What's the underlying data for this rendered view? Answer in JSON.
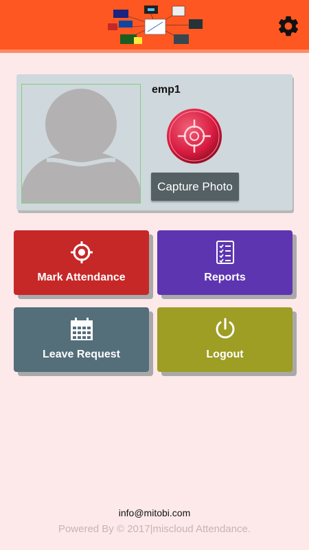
{
  "header": {
    "brand_color": "#ff5722",
    "settings_icon": "gear-icon"
  },
  "profile": {
    "employee_name": "emp1",
    "avatar_icon": "user-silhouette-icon",
    "capture_icon": "target-icon",
    "capture_label": "Capture Photo"
  },
  "tiles": [
    {
      "label": "Mark Attendance",
      "icon": "target-icon",
      "color": "#c62828"
    },
    {
      "label": "Reports",
      "icon": "checklist-icon",
      "color": "#5e35b1"
    },
    {
      "label": "Leave Request",
      "icon": "calendar-icon",
      "color": "#546e7a"
    },
    {
      "label": "Logout",
      "icon": "power-icon",
      "color": "#9e9d24"
    }
  ],
  "footer": {
    "email": "info@mitobi.com",
    "powered_by": "Powered By © 2017|miscloud Attendance."
  }
}
